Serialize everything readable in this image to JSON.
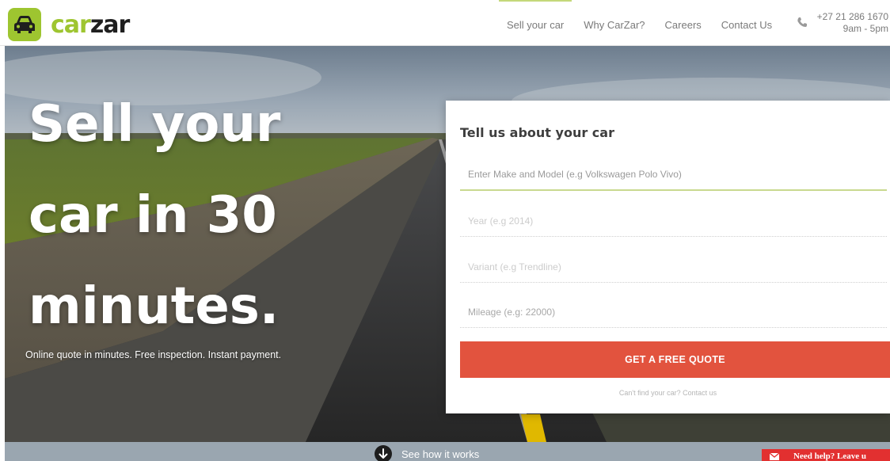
{
  "brand": {
    "logo_part1": "car",
    "logo_part2": "zar",
    "accent_color": "#9ec530",
    "cta_color": "#e2533e"
  },
  "nav": {
    "items": [
      {
        "label": "Sell your car",
        "active": true
      },
      {
        "label": "Why CarZar?"
      },
      {
        "label": "Careers"
      },
      {
        "label": "Contact Us"
      }
    ],
    "phone_number": "+27 21 286 1670",
    "hours": "9am - 5pm"
  },
  "hero": {
    "title_line1": "Sell your",
    "title_line2": "car in 30",
    "title_line3": "minutes.",
    "subtitle": "Online quote in minutes. Free inspection. Instant payment."
  },
  "form": {
    "title": "Tell us about your car",
    "make_model_placeholder": "Enter Make and Model (e.g Volkswagen Polo Vivo)",
    "year_placeholder": "Year (e.g 2014)",
    "variant_placeholder": "Variant (e.g Trendline)",
    "mileage_placeholder": "Mileage (e.g: 22000)",
    "submit_label": "GET A FREE QUOTE",
    "help_text": "Can't find your car? Contact us"
  },
  "footer": {
    "see_how_label": "See how it works",
    "need_help_label": "Need help? Leave u"
  },
  "icons": {
    "logo": "car-icon",
    "phone": "phone-icon",
    "see_how": "arrow-down-icon",
    "chat": "mail-icon"
  }
}
